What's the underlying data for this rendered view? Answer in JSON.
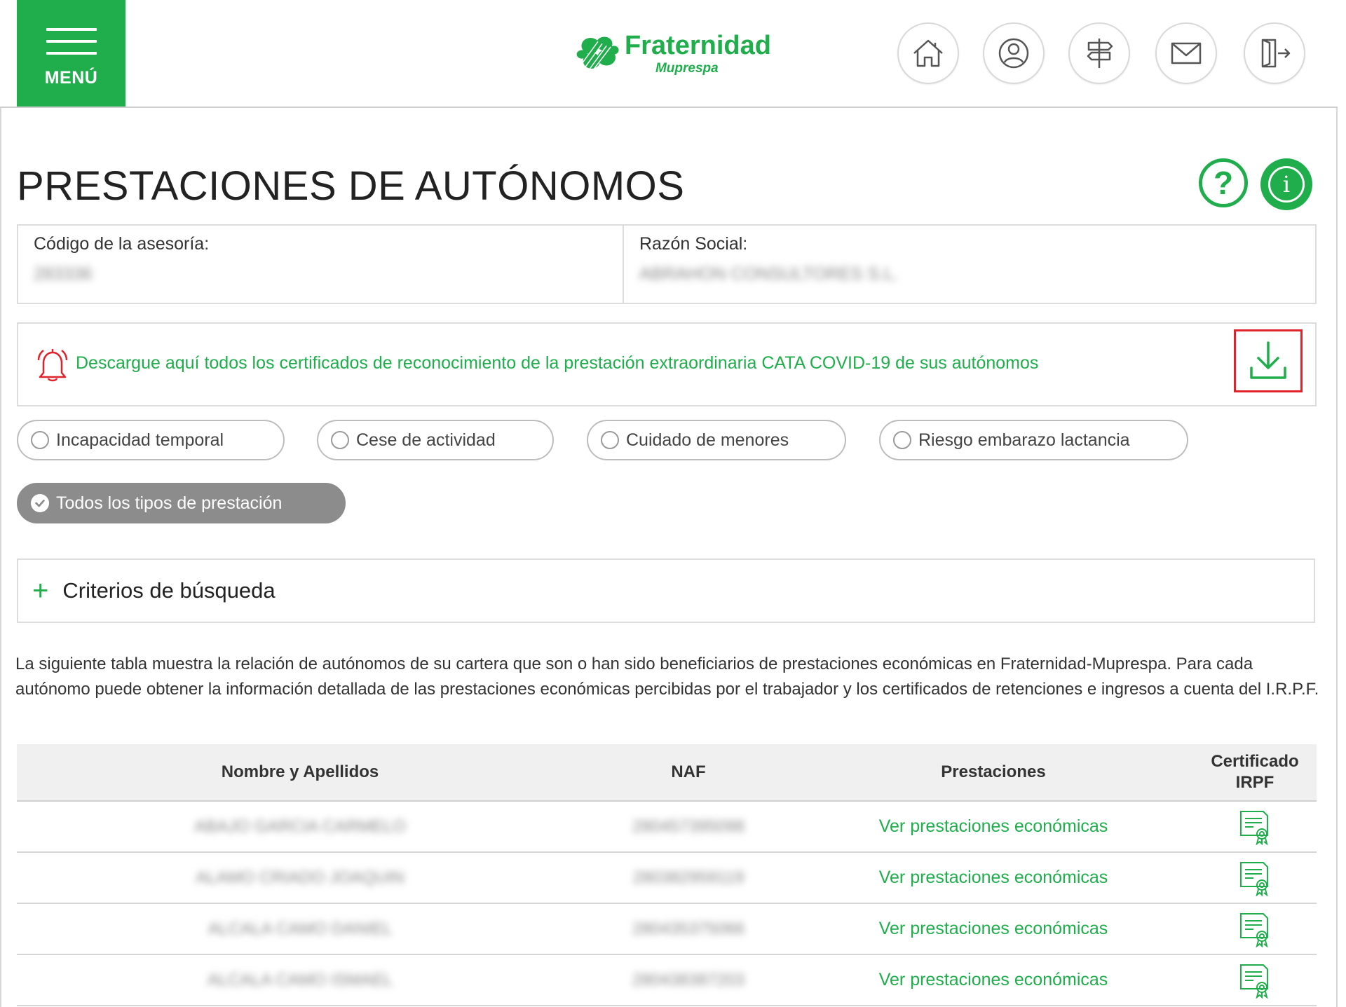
{
  "header": {
    "menu_label": "MENÚ",
    "logo_name": "Fraternidad",
    "logo_sub": "Muprespa",
    "nav_icons": [
      "home-icon",
      "user-icon",
      "signpost-icon",
      "mail-icon",
      "logout-icon"
    ]
  },
  "page": {
    "title": "PRESTACIONES DE AUTÓNOMOS",
    "help_glyph": "?",
    "info_glyph": "i"
  },
  "company": {
    "code_label": "Código de la asesoría:",
    "code_value": "283336",
    "name_label": "Razón Social:",
    "name_value": "ABRAHON CONSULTORES S.L."
  },
  "alert": {
    "text": "Descargue aquí todos los certificados de reconocimiento de la prestación extraordinaria CATA COVID-19 de sus autónomos"
  },
  "filters": {
    "options": [
      {
        "label": "Incapacidad temporal",
        "selected": false
      },
      {
        "label": "Cese de actividad",
        "selected": false
      },
      {
        "label": "Cuidado de menores",
        "selected": false
      },
      {
        "label": "Riesgo embarazo lactancia",
        "selected": false
      },
      {
        "label": "Todos los tipos de prestación",
        "selected": true
      }
    ]
  },
  "search": {
    "toggle_glyph": "+",
    "label": "Criterios de búsqueda"
  },
  "description": "La siguiente tabla muestra la relación de autónomos de su cartera que son o han sido beneficiarios de prestaciones económicas en Fraternidad-Muprespa. Para cada autónomo puede obtener la información detallada de las prestaciones económicas percibidas por el trabajador y los certificados de retenciones e ingresos a cuenta del I.R.P.F.",
  "table": {
    "headers": {
      "name": "Nombre y Apellidos",
      "naf": "NAF",
      "prestaciones": "Prestaciones",
      "certificado": "Certificado IRPF"
    },
    "rows": [
      {
        "name": "ABAJO GARCIA CARMELO",
        "naf": "280457395098",
        "link": "Ver prestaciones económicas"
      },
      {
        "name": "ALAMO CRIADO JOAQUIN",
        "naf": "280382959119",
        "link": "Ver prestaciones económicas"
      },
      {
        "name": "ALCALA CAMO DANIEL",
        "naf": "280435375066",
        "link": "Ver prestaciones económicas"
      },
      {
        "name": "ALCALA CAMO ISMAEL",
        "naf": "280438387203",
        "link": "Ver prestaciones económicas"
      }
    ]
  },
  "colors": {
    "brand_green": "#1fae4b",
    "alert_border_red": "#e0232a",
    "active_pill_gray": "#8c8c8c"
  }
}
